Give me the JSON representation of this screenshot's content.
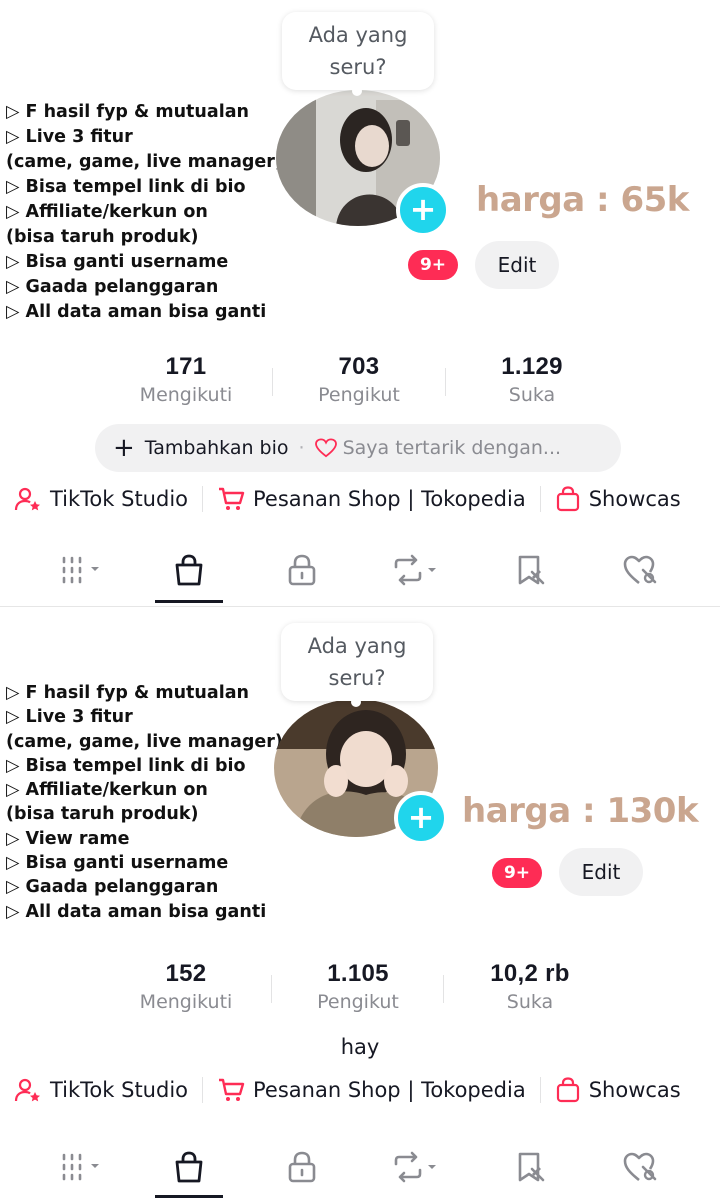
{
  "panels": [
    {
      "bubble": "Ada yang seru?",
      "features": [
        "▷ F hasil fyp & mutualan",
        "▷ Live 3 fitur",
        "(came, game, live manager)",
        "▷ Bisa tempel link di bio",
        "▷ Affiliate/kerkun on",
        "(bisa taruh produk)",
        "▷ Bisa ganti username",
        "▷ Gaada pelanggaran",
        "▷ All data aman bisa ganti"
      ],
      "price": "harga : 65k",
      "notif_badge": "9+",
      "edit_label": "Edit",
      "stats": [
        {
          "value": "171",
          "label": "Mengikuti"
        },
        {
          "value": "703",
          "label": "Pengikut"
        },
        {
          "value": "1.129",
          "label": "Suka"
        }
      ],
      "bio_add": "Tambahkan bio",
      "bio_interest": "Saya tertarik dengan...",
      "links": [
        "TikTok Studio",
        "Pesanan Shop | Tokopedia",
        "Showcas"
      ]
    },
    {
      "bubble": "Ada yang seru?",
      "features": [
        "▷ F hasil fyp & mutualan",
        "▷ Live 3 fitur",
        "(came, game, live manager)",
        "▷ Bisa tempel link di bio",
        "▷ Affiliate/kerkun on",
        "(bisa taruh produk)",
        "▷ View rame",
        "▷ Bisa ganti username",
        "▷ Gaada pelanggaran",
        "▷ All data aman bisa ganti"
      ],
      "price": "harga : 130k",
      "notif_badge": "9+",
      "edit_label": "Edit",
      "stats": [
        {
          "value": "152",
          "label": "Mengikuti"
        },
        {
          "value": "1.105",
          "label": "Pengikut"
        },
        {
          "value": "10,2 rb",
          "label": "Suka"
        }
      ],
      "bio": "hay",
      "links": [
        "TikTok Studio",
        "Pesanan Shop | Tokopedia",
        "Showcas"
      ]
    }
  ],
  "tab_icons": [
    "grid-icon",
    "shopping-bag-icon",
    "lock-icon",
    "repost-icon",
    "saved-icon",
    "liked-icon"
  ],
  "colors": {
    "price": "#caa68f",
    "badge": "#fe2c55",
    "plus": "#20d5ec",
    "link_icon": "#fe2c55"
  }
}
